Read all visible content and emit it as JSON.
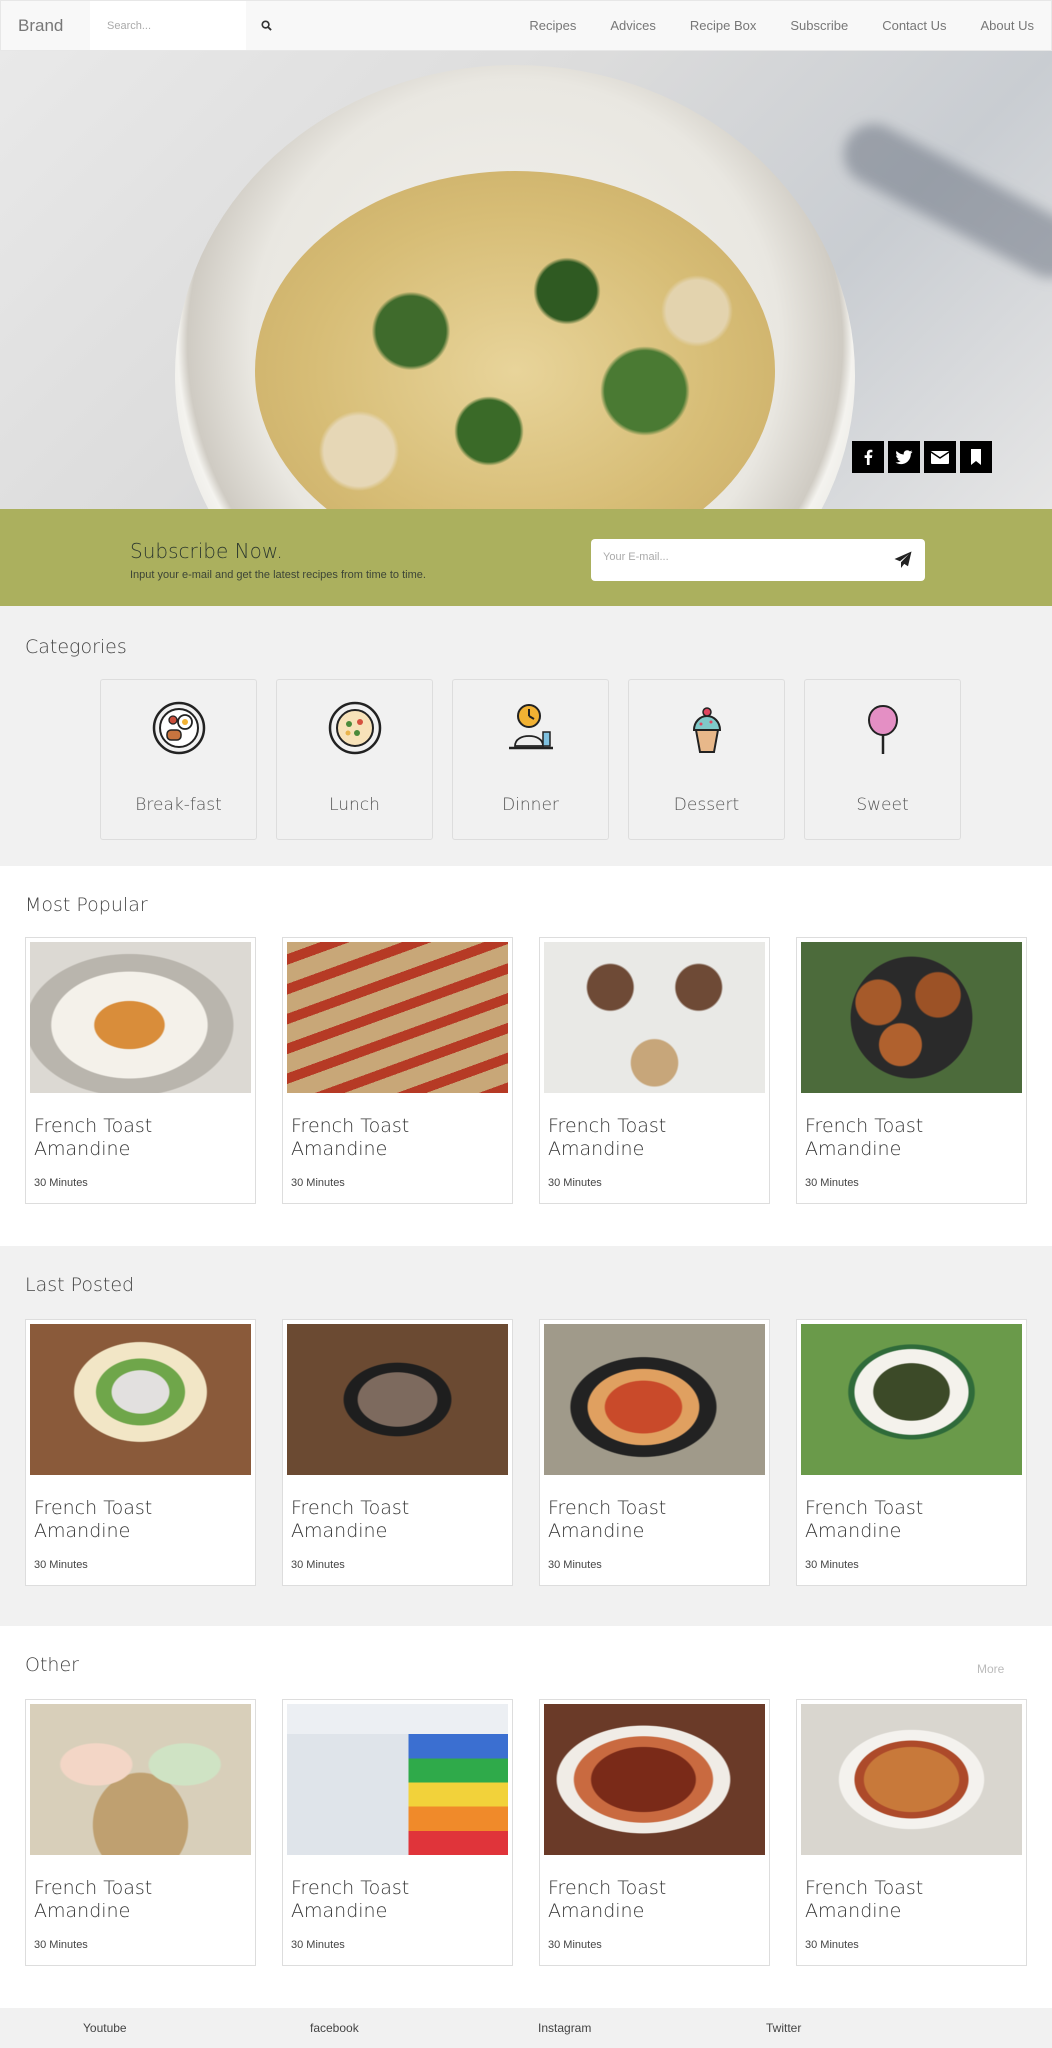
{
  "nav": {
    "brand": "Brand",
    "search_placeholder": "Search...",
    "links": [
      "Recipes",
      "Advices",
      "Recipe Box",
      "Subscribe",
      "Contact Us",
      "About Us"
    ]
  },
  "hero": {
    "share_icons": [
      "facebook-icon",
      "twitter-icon",
      "envelope-icon",
      "bookmark-icon"
    ]
  },
  "subscribe": {
    "title": "Subscribe Now.",
    "description": "Input your e-mail and get the latest recipes from time to time.",
    "email_placeholder": "Your E-mail..."
  },
  "categories": {
    "title": "Categories",
    "items": [
      "Break-fast",
      "Lunch",
      "Dinner",
      "Dessert",
      "Sweet"
    ]
  },
  "most_popular": {
    "title": "Most Popular",
    "cards": [
      {
        "title": "French Toast Amandine",
        "time": "30 Minutes"
      },
      {
        "title": "French Toast Amandine",
        "time": "30 Minutes"
      },
      {
        "title": "French Toast Amandine",
        "time": "30 Minutes"
      },
      {
        "title": "French Toast Amandine",
        "time": "30 Minutes"
      }
    ]
  },
  "last_posted": {
    "title": "Last Posted",
    "cards": [
      {
        "title": "French Toast Amandine",
        "time": "30 Minutes"
      },
      {
        "title": "French Toast Amandine",
        "time": "30 Minutes"
      },
      {
        "title": "French Toast Amandine",
        "time": "30 Minutes"
      },
      {
        "title": "French Toast Amandine",
        "time": "30 Minutes"
      }
    ]
  },
  "other": {
    "title": "Other",
    "more": "More",
    "cards": [
      {
        "title": "French Toast Amandine",
        "time": "30 Minutes"
      },
      {
        "title": "French Toast Amandine",
        "time": "30 Minutes"
      },
      {
        "title": "French Toast Amandine",
        "time": "30 Minutes"
      },
      {
        "title": "French Toast Amandine",
        "time": "30 Minutes"
      }
    ]
  },
  "footer": {
    "links": [
      "Youtube",
      "facebook",
      "Instagram",
      "Twitter"
    ]
  },
  "colors": {
    "subscribe_bg": "#abb05e",
    "section_gray": "#f1f1f1",
    "share_bg": "#000000"
  }
}
